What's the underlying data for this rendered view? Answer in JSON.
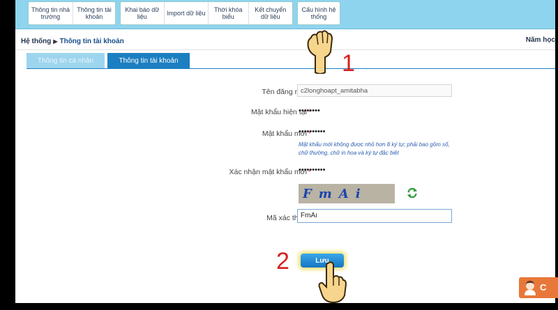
{
  "toolbar": {
    "group1": [
      "Thông tin nhà\ntrường",
      "Thông tin tài\nkhoản"
    ],
    "group2": [
      "Khai báo dữ\nliệu",
      "Import dữ liệu",
      "Thời khóa\nbiểu",
      "Kết chuyển\ndữ liệu"
    ],
    "group3": [
      "Cấu hình hệ\nthống"
    ]
  },
  "breadcrumb": {
    "root": "Hệ thống",
    "current": "Thông tin tài khoản",
    "year_label": "Năm học"
  },
  "tabs": [
    {
      "label": "Thông tin cá nhân",
      "active": false
    },
    {
      "label": "Thông tin tài khoản",
      "active": true
    }
  ],
  "form": {
    "username_label": "Tên đăng nhập",
    "username_value": "c2longhoapt_amitabha",
    "current_password_label": "Mật khẩu hiện tại",
    "current_password_value": "••••••••",
    "new_password_label": "Mật khẩu mới",
    "new_password_value": "••••••••••",
    "password_hint": "Mật khẩu mới không được nhỏ hơn 8 ký tự; phải bao gồm số, chữ thường, chữ in hoa và ký tự đặc biệt",
    "confirm_password_label": "Xác nhận mật khẩu mới",
    "confirm_password_value": "••••••••••",
    "captcha_text": "FmAi",
    "captcha_label": "Mã xác thực",
    "captcha_value": "FmAı",
    "required_mark": "*",
    "save_label": "Lưu"
  },
  "annotations": {
    "step1": "1",
    "step2": "2"
  },
  "colors": {
    "toolbar_bg": "#8fd4ee",
    "tab_active": "#1b7fc1",
    "step_number": "#d82020",
    "save_button": "#1b7fc1"
  }
}
